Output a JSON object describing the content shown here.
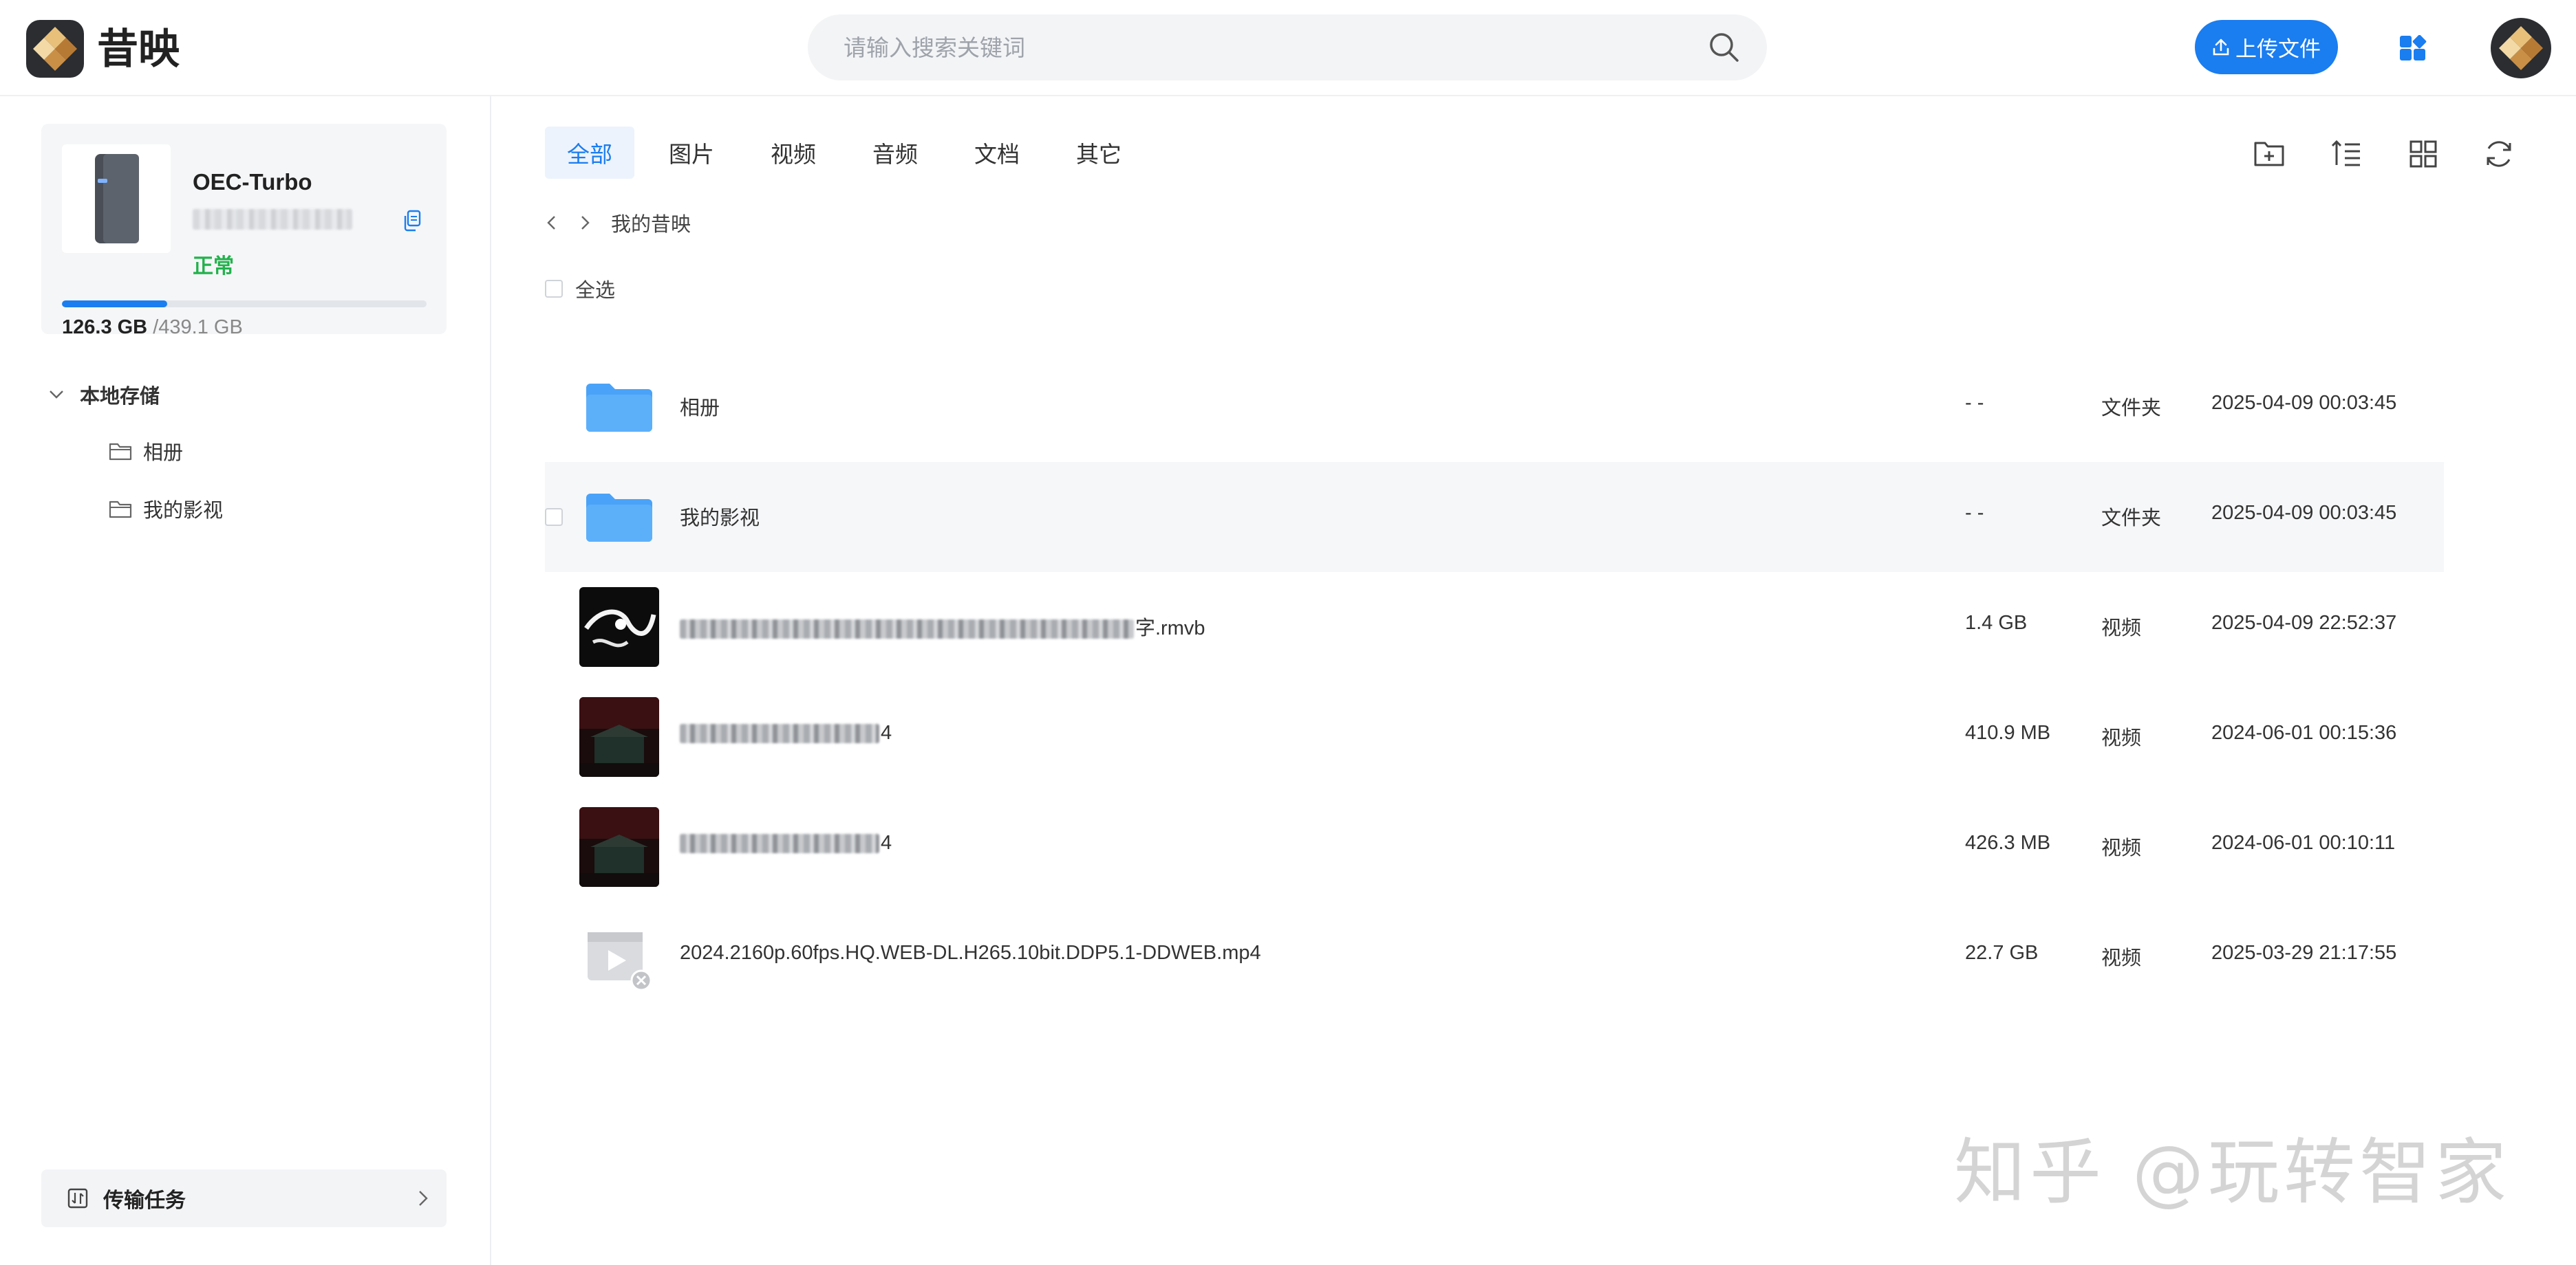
{
  "app": {
    "name": "昔映"
  },
  "search": {
    "placeholder": "请输入搜索关键词"
  },
  "header": {
    "upload_label": "上传文件"
  },
  "device": {
    "name": "OEC-Turbo",
    "status": "正常",
    "used": "126.3 GB",
    "total": "/439.1 GB",
    "usage_fraction": 0.288
  },
  "sidebar": {
    "root_label": "本地存储",
    "items": [
      {
        "label": "相册"
      },
      {
        "label": "我的影视"
      }
    ],
    "transfer_label": "传输任务"
  },
  "tabs": [
    {
      "label": "全部",
      "active": true
    },
    {
      "label": "图片"
    },
    {
      "label": "视频"
    },
    {
      "label": "音频"
    },
    {
      "label": "文档"
    },
    {
      "label": "其它"
    }
  ],
  "breadcrumb": {
    "current": "我的昔映"
  },
  "select_all_label": "全选",
  "files": [
    {
      "name": "相册",
      "size": "- -",
      "type": "文件夹",
      "date": "2025-04-09 00:03:45",
      "thumb": "folder"
    },
    {
      "name": "我的影视",
      "size": "- -",
      "type": "文件夹",
      "date": "2025-04-09 00:03:45",
      "thumb": "folder"
    },
    {
      "name_visible": "字.rmvb",
      "size": "1.4 GB",
      "type": "视频",
      "date": "2025-04-09 22:52:37",
      "thumb": "video-dark"
    },
    {
      "name_visible": "4",
      "size": "410.9 MB",
      "type": "视频",
      "date": "2024-06-01 00:15:36",
      "thumb": "video-red"
    },
    {
      "name_visible": "4",
      "size": "426.3 MB",
      "type": "视频",
      "date": "2024-06-01 00:10:11",
      "thumb": "video-red"
    },
    {
      "name_visible": "2024.2160p.60fps.HQ.WEB-DL.H265.10bit.DDP5.1-DDWEB.mp4",
      "size": "22.7 GB",
      "type": "视频",
      "date": "2025-03-29 21:17:55",
      "thumb": "video-placeholder"
    }
  ],
  "watermark": "知乎 @玩转智家",
  "colors": {
    "accent": "#1a7df0",
    "status_ok": "#22b24c",
    "folder": "#4aa3f8"
  }
}
